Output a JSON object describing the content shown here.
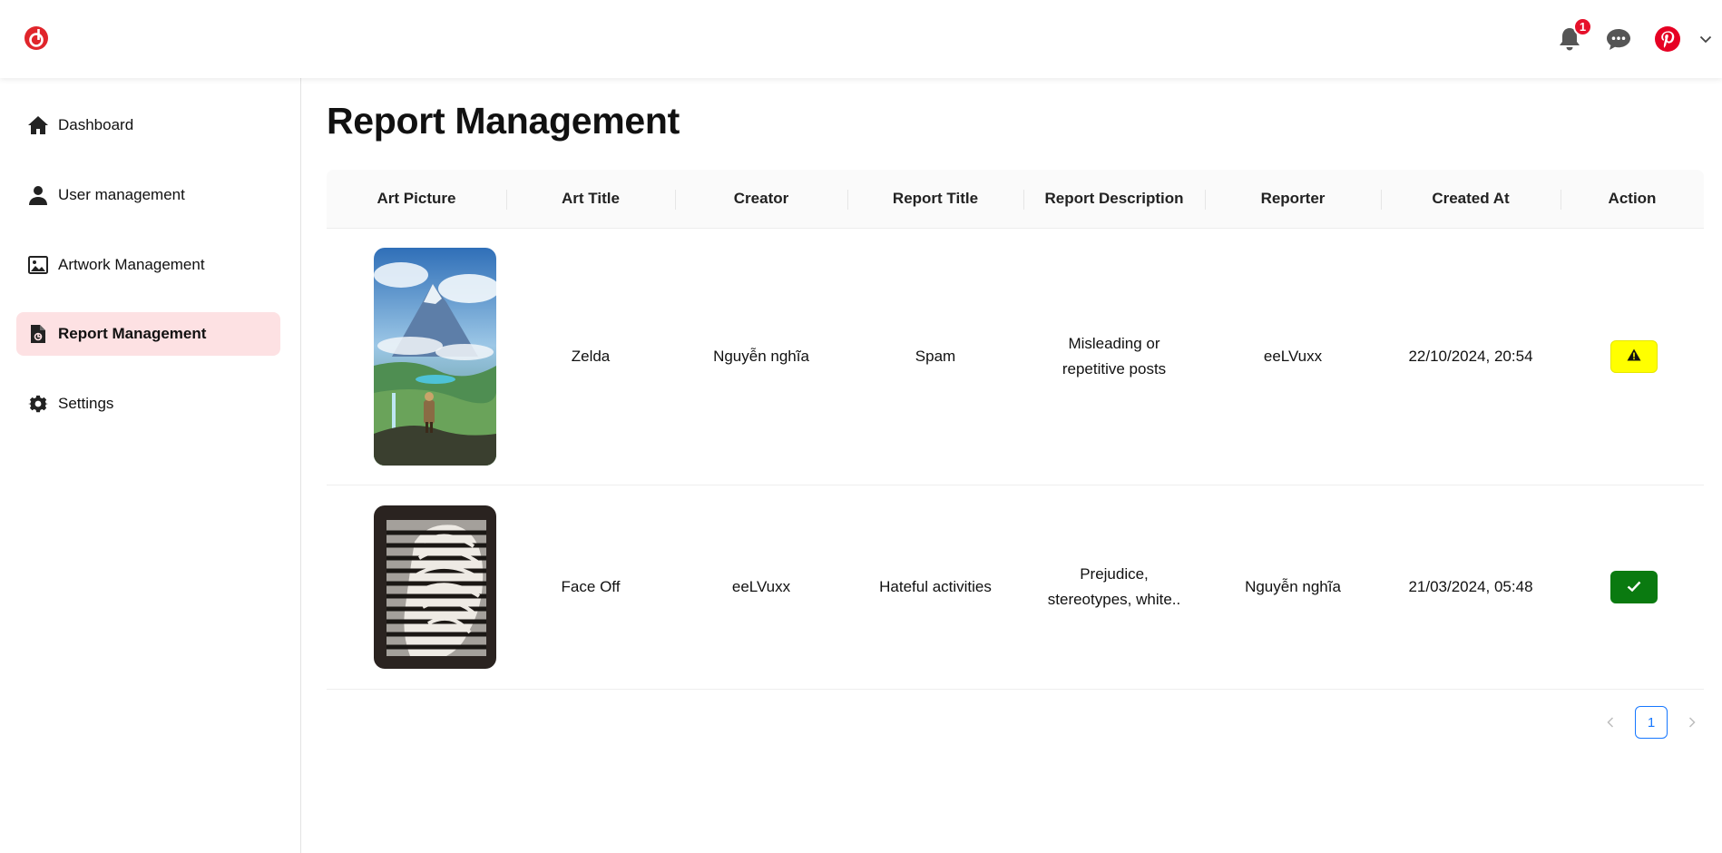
{
  "topbar": {
    "logo_icon": "brand-logo-icon",
    "notification_count": "1",
    "icons": [
      "bell-icon",
      "chat-bubble-icon",
      "pinterest-avatar-icon",
      "chevron-down-icon"
    ],
    "brand_color": "#e60023"
  },
  "sidebar": {
    "items": [
      {
        "label": "Dashboard",
        "icon": "home-icon"
      },
      {
        "label": "User management",
        "icon": "user-icon"
      },
      {
        "label": "Artwork Management",
        "icon": "image-icon"
      },
      {
        "label": "Report Management",
        "icon": "report-icon",
        "active": true
      },
      {
        "label": "Settings",
        "icon": "gear-icon"
      }
    ]
  },
  "main": {
    "title": "Report Management",
    "table": {
      "headers": [
        "Art Picture",
        "Art Title",
        "Creator",
        "Report Title",
        "Report Description",
        "Reporter",
        "Created At",
        "Action"
      ],
      "rows": [
        {
          "art_title": "Zelda",
          "creator": "Nguyễn nghĩa",
          "report_title": "Spam",
          "report_description": "Misleading or repetitive posts",
          "reporter": "eeLVuxx",
          "created_at": "22/10/2024, 20:54",
          "action_icon": "warning-icon",
          "action_color": "#ffff00"
        },
        {
          "art_title": "Face Off",
          "creator": "eeLVuxx",
          "report_title": "Hateful activities",
          "report_description": "Prejudice, stereotypes, white..",
          "reporter": "Nguyễn nghĩa",
          "created_at": "21/03/2024, 05:48",
          "action_icon": "check-icon",
          "action_color": "#0a7a10"
        }
      ]
    },
    "pagination": {
      "current_page": "1"
    }
  }
}
